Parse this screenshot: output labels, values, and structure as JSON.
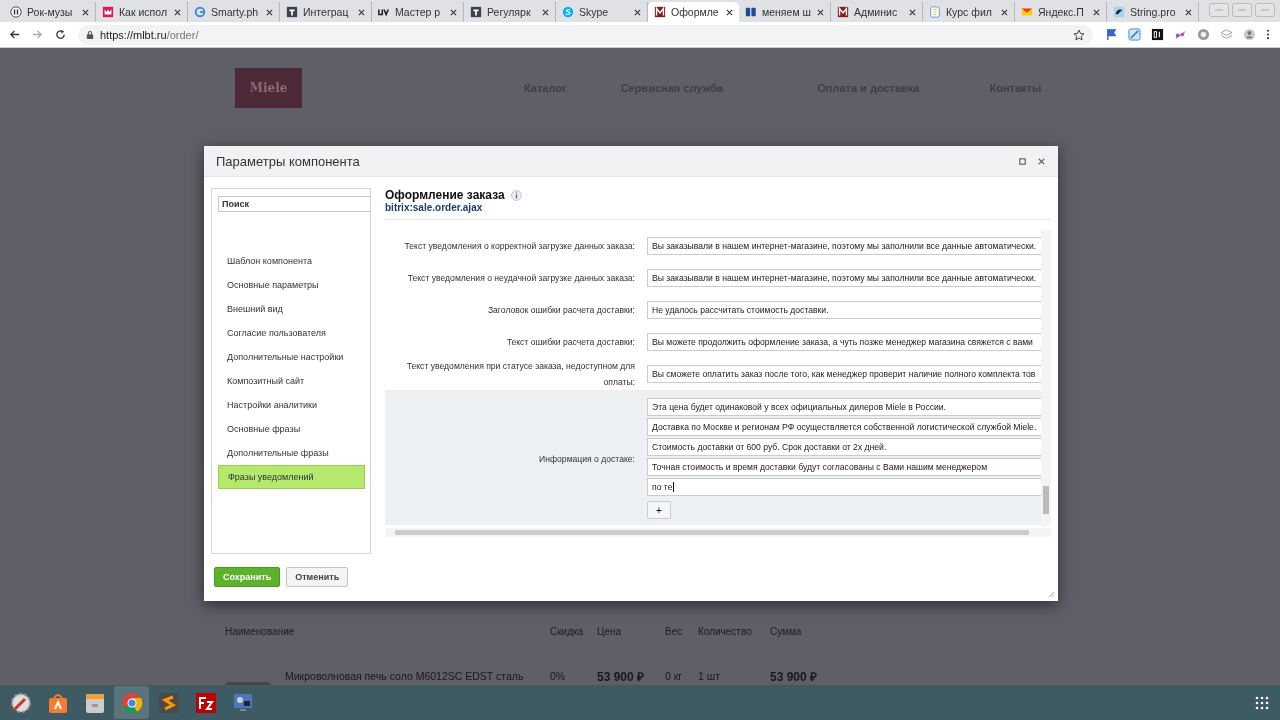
{
  "browser": {
    "tabs": [
      {
        "title": "Рок-музы",
        "kind": "pause",
        "selected": false
      },
      {
        "title": "Как испол",
        "kind": "crown",
        "selected": false
      },
      {
        "title": "Smarty.ph",
        "kind": "g",
        "selected": false
      },
      {
        "title": "Интеграц",
        "kind": "square",
        "selected": false
      },
      {
        "title": "Мастер р",
        "kind": "uv",
        "selected": false
      },
      {
        "title": "Регулярк",
        "kind": "square",
        "selected": false
      },
      {
        "title": "Skype",
        "kind": "skype",
        "selected": false
      },
      {
        "title": "Оформле",
        "kind": "m",
        "selected": true
      },
      {
        "title": "меняем ш",
        "kind": "num",
        "selected": false
      },
      {
        "title": "Админис",
        "kind": "m",
        "selected": false
      },
      {
        "title": "Курс фил",
        "kind": "doc",
        "selected": false
      },
      {
        "title": "Яндекс.П",
        "kind": "mail",
        "selected": false
      },
      {
        "title": "String.pro",
        "kind": "bird",
        "selected": false
      }
    ],
    "address": {
      "host": "https://mlbt.ru",
      "path": "/order/"
    }
  },
  "site": {
    "logo": "Miele",
    "nav": [
      "Каталог",
      "Сервисная служба",
      "Оплата и доставка",
      "Контакты"
    ],
    "table": {
      "columns": [
        "Наименование",
        "Скидка",
        "Цена",
        "Вес",
        "Количество",
        "Сумма"
      ],
      "rows": [
        {
          "name": "Микроволновая печь соло M6012SC EDST сталь",
          "discount": "0%",
          "price": "53 900 ₽",
          "weight": "0 кг",
          "quantity": "1 шт",
          "sum": "53 900 ₽"
        }
      ]
    }
  },
  "dialog": {
    "title": "Параметры компонента",
    "search": {
      "placeholder": "Поиск"
    },
    "sections": [
      {
        "label": "Шаблон компонента",
        "selected": false
      },
      {
        "label": "Основные параметры",
        "selected": false
      },
      {
        "label": "Внешний вид",
        "selected": false
      },
      {
        "label": "Согласие пользователя",
        "selected": false
      },
      {
        "label": "Дополнительные настройки",
        "selected": false
      },
      {
        "label": "Композитный сайт",
        "selected": false
      },
      {
        "label": "Настройки аналитики",
        "selected": false
      },
      {
        "label": "Основные фразы",
        "selected": false
      },
      {
        "label": "Дополнительные фразы",
        "selected": false
      },
      {
        "label": "Фразы уведомлений",
        "selected": true
      }
    ],
    "component": {
      "title": "Оформление заказа",
      "code": "bitrix:sale.order.ajax"
    },
    "fields": [
      {
        "label": "Текст уведомления о корректной загрузке данных заказа:",
        "active": false,
        "values": [
          "Вы заказывали в нашем интернет-магазине, поэтому мы заполнили все данные автоматически."
        ]
      },
      {
        "label": "Текст уведомления о неудачной загрузке данных заказа:",
        "active": false,
        "values": [
          "Вы заказывали в нашем интернет-магазине, поэтому мы заполнили все данные автоматически."
        ]
      },
      {
        "label": "Заголовок ошибки расчета доставки:",
        "active": false,
        "values": [
          "Не удалось рассчитать стоимость доставки."
        ]
      },
      {
        "label": "Текст ошибки расчета доставки:",
        "active": false,
        "values": [
          "Вы можете продолжить оформление заказа, а чуть позже менеджер магазина свяжется с вами"
        ]
      },
      {
        "label": "Текст уведомления при статусе заказа, недоступном для оплаты:",
        "active": false,
        "values": [
          "Вы сможете оплатить заказ после того, как менеджер проверит наличие полного комплекта тов"
        ]
      },
      {
        "label": "Информация о достаке:",
        "active": true,
        "add": "+",
        "values": [
          "Эта цена будет одинаковой у всех официальных дилеров Miele в России.",
          "Доставка по Москве и регионам РФ осуществляется собственной логистической службой Miele.",
          "Стоимость доставки от 600 руб. Срок доставки от 2х дней.",
          "Точная стоимость и время доставки будут согласованы с Вами нашим менеджером",
          "по те"
        ]
      }
    ],
    "buttons": [
      {
        "label": "Сохранить",
        "kind": "primary"
      },
      {
        "label": "Отменить",
        "kind": "secondary"
      }
    ]
  },
  "taskbar": {
    "apps": [
      {
        "kind": "settings",
        "selected": false
      },
      {
        "kind": "store",
        "selected": false
      },
      {
        "kind": "files",
        "selected": false
      },
      {
        "kind": "browser",
        "selected": true
      },
      {
        "kind": "editor",
        "selected": false
      },
      {
        "kind": "ftp",
        "selected": false
      },
      {
        "kind": "remote",
        "selected": false
      }
    ]
  }
}
